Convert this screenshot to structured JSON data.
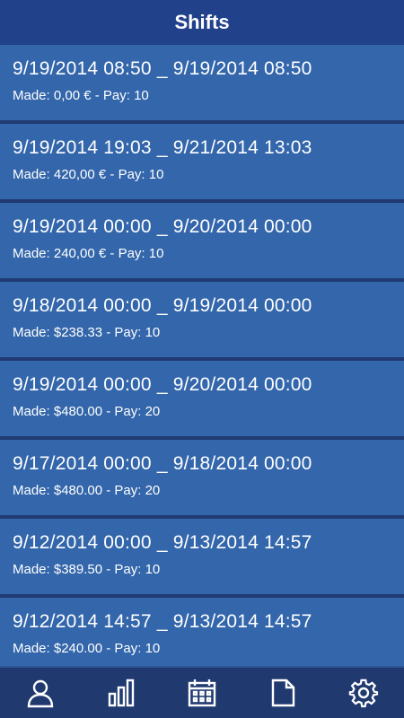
{
  "header": {
    "title": "Shifts"
  },
  "shifts": [
    {
      "range": "9/19/2014 08:50 _ 9/19/2014 08:50",
      "details": "Made: 0,00 € - Pay: 10"
    },
    {
      "range": "9/19/2014 19:03 _ 9/21/2014 13:03",
      "details": "Made: 420,00 € - Pay: 10"
    },
    {
      "range": "9/19/2014 00:00 _ 9/20/2014 00:00",
      "details": "Made: 240,00 € - Pay: 10"
    },
    {
      "range": "9/18/2014 00:00 _ 9/19/2014 00:00",
      "details": "Made: $238.33 - Pay: 10"
    },
    {
      "range": "9/19/2014 00:00 _ 9/20/2014 00:00",
      "details": "Made: $480.00 - Pay: 20"
    },
    {
      "range": "9/17/2014 00:00 _ 9/18/2014 00:00",
      "details": "Made: $480.00 - Pay: 20"
    },
    {
      "range": "9/12/2014 00:00 _ 9/13/2014 14:57",
      "details": "Made: $389.50 - Pay: 10"
    },
    {
      "range": "9/12/2014 14:57 _ 9/13/2014 14:57",
      "details": "Made: $240.00 - Pay: 10"
    }
  ],
  "bottom_nav": [
    {
      "icon": "user-icon"
    },
    {
      "icon": "bar-chart-icon"
    },
    {
      "icon": "calendar-icon"
    },
    {
      "icon": "document-icon"
    },
    {
      "icon": "gear-icon"
    }
  ],
  "colors": {
    "header_bg": "#21418a",
    "item_bg": "#3366ab",
    "separator": "#203b73",
    "nav_bg": "#203a70",
    "text": "#ffffff"
  }
}
